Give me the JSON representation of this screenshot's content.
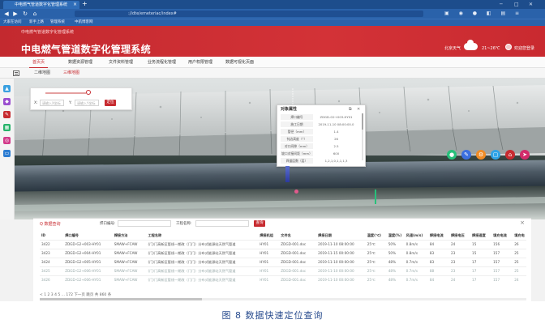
{
  "browser": {
    "tab_title": "中电燃气管道数字化管理系统",
    "tab_close": "×",
    "tab_new": "+",
    "url": "://dte/emeteriac/index#",
    "bookmarks": [
      "大家在访问",
      "新手上路",
      "管理系统",
      "中航博客网"
    ]
  },
  "header": {
    "system_label": "中电燃气管道数字化管理系统",
    "title": "中电燃气管道数字化管理系统",
    "weather_text": "北京天气",
    "temperature": "21~26℃",
    "user_label": "欢迎您登录"
  },
  "menu": {
    "items": [
      {
        "label": "首页页"
      },
      {
        "label": "数据资源管理"
      },
      {
        "label": "文件资料管理"
      },
      {
        "label": "业务流程化管理"
      },
      {
        "label": "用户权限管理"
      },
      {
        "label": "数据可视化页面"
      }
    ]
  },
  "subtabs": [
    "二维地图",
    "三维地图"
  ],
  "coords": {
    "x_label": "X:",
    "x_placeholder": "请输入X坐标",
    "y_label": "Y:",
    "y_placeholder": "请输入Y坐标",
    "locate_button": "定位"
  },
  "attr_popup": {
    "title": "对象属性",
    "rows": [
      {
        "key": "焊口编号",
        "value": "ZDGD-G2+003-HY01"
      },
      {
        "key": "施工日期",
        "value": "2019-11-10 08:00:00.0"
      },
      {
        "key": "管径（mm）",
        "value": "1.4"
      },
      {
        "key": "钝边高度（°）",
        "value": "26"
      },
      {
        "key": "对口间隙（mm）",
        "value": "2.5"
      },
      {
        "key": "坡口对接间距（mm）",
        "value": "600"
      },
      {
        "key": "焊道层数（层）",
        "value": "1,2,1,0,1,1,1,3"
      }
    ]
  },
  "query": {
    "title": "Q 数据查询",
    "weld_no_label": "焊口编号:",
    "process_label": "工程名称:",
    "search_button": "查询",
    "close": "×",
    "columns": [
      "ID",
      "焊口编号",
      "焊接方法",
      "工程名称",
      "焊接机组",
      "文件名",
      "焊接日期",
      "温度(℃)",
      "湿度(%)",
      "风速(m/s)",
      "焊接电流",
      "焊接电压",
      "焊接速度",
      "填充电流",
      "填充电"
    ],
    "rows": [
      [
        "3422",
        "ZDGD-G2+003-HY01",
        "SMAW+FCAW",
        "(门)门高新区管线一期改（门门）分布式能源站天然气管道",
        "HY01",
        "ZDGD-001.doc",
        "2019-11-10 08:00:00",
        "25℃",
        "50%",
        "0.8m/s",
        "84",
        "24",
        "15",
        "156",
        "26"
      ],
      [
        "3423",
        "ZDGD-G2+004-HY01",
        "SMAW+FCAW",
        "(门)门高新区管线一期改（门门）分布式能源站天然气管道",
        "HY01",
        "ZDGD-001.doc",
        "2019-11-15 00:00:00",
        "25℃",
        "50%",
        "0.8m/s",
        "83",
        "23",
        "15",
        "157",
        "25"
      ],
      [
        "3424",
        "ZDGD-G2+005-HY01",
        "SMAW+FCAW",
        "(门)门高新区管线一期改（门门）分布式能源站天然气管道",
        "HY01",
        "ZDGD-001.doc",
        "2019-11-10 00:00:00",
        "25℃",
        "48%",
        "0.7m/s",
        "83",
        "23",
        "17",
        "157",
        "25"
      ],
      [
        "3425",
        "ZDGD-G2+006-HY01",
        "SMAW+FCAW",
        "(门)门高新区管线一期改（门门）分布式能源站天然气管道",
        "HY01",
        "ZDGD-001.doc",
        "2019-11-10 00:00:00",
        "25℃",
        "48%",
        "0.7m/s",
        "88",
        "23",
        "17",
        "157",
        "25"
      ],
      [
        "3426",
        "ZDGD-G2+006-HY01",
        "SMAW+FCAW",
        "(门)门高新区管线一期改（门门）分布式能源站天然气管道",
        "HY01",
        "ZDGD-001.doc",
        "2019-11-10 00:00:00",
        "25℃",
        "48%",
        "0.7m/s",
        "84",
        "24",
        "17",
        "157",
        "24"
      ]
    ],
    "pager": "< 1 2 3 4 5 ... 172  下一页  跳页  共 860 条"
  },
  "caption": "图 8   数据快速定位查询",
  "colors": {
    "brand_red": "#c72b30",
    "browser_blue": "#2a62aa",
    "caption_blue": "#2a4d8f"
  }
}
